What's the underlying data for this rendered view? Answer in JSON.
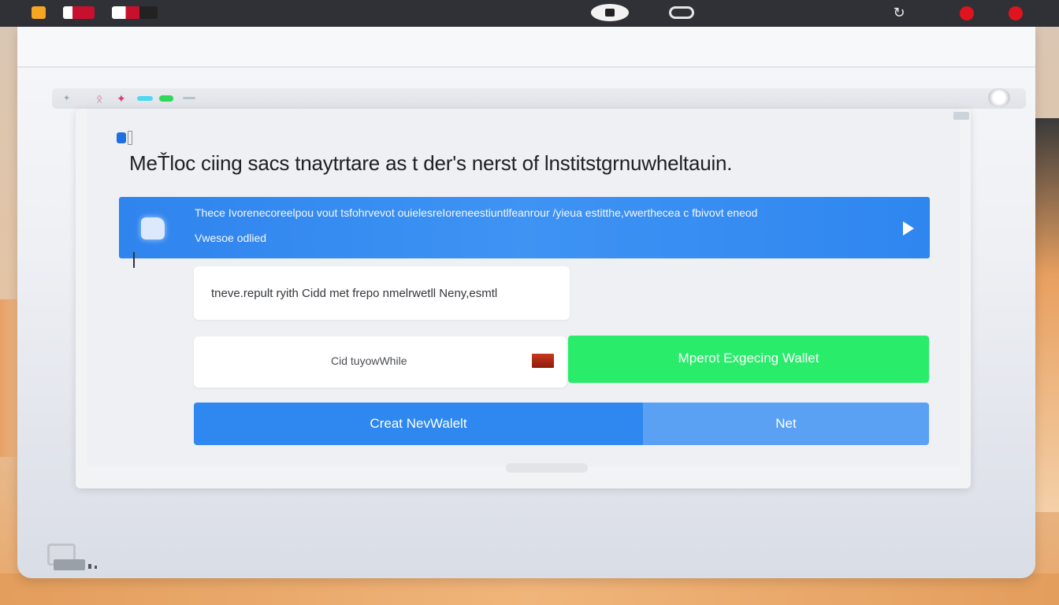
{
  "dialog": {
    "title": "MeŤloc ciing sacs tnaytrtare as t der's nerst of lnstitstgrnuwheltauin.",
    "banner": {
      "line1": "Thece Ivorenecoreelpou vout tsfohrvevot ouielesreIoreneestiuntlfeanrour /yieua estitthe,vwerthecea c fbivovt eneod",
      "line2": "Vwesoe odlied"
    },
    "phrase_field": {
      "value": "tneve.repult ryith Cidd met frepo nmelrwetll Neny,esmtl"
    },
    "wallet_input": {
      "value": "Cid tuyowWhile"
    },
    "buttons": {
      "import": "Mperot Exgecing Wallet",
      "create": "Creat NevWalelt",
      "next": "Net"
    }
  },
  "colors": {
    "primary_blue": "#2f88f0",
    "import_green": "#29ec6a",
    "topbar": "#2f3136",
    "status_red": "#e0141e"
  },
  "icons": {
    "topbar_left": [
      "app-icon",
      "flag-icon",
      "flag-icon"
    ],
    "topbar_center": [
      "eye-icon",
      "link-icon"
    ],
    "topbar_right": [
      "refresh-icon",
      "record-dot-icon",
      "record-dot-icon"
    ],
    "banner": "document-icon",
    "banner_action": "play-icon"
  }
}
